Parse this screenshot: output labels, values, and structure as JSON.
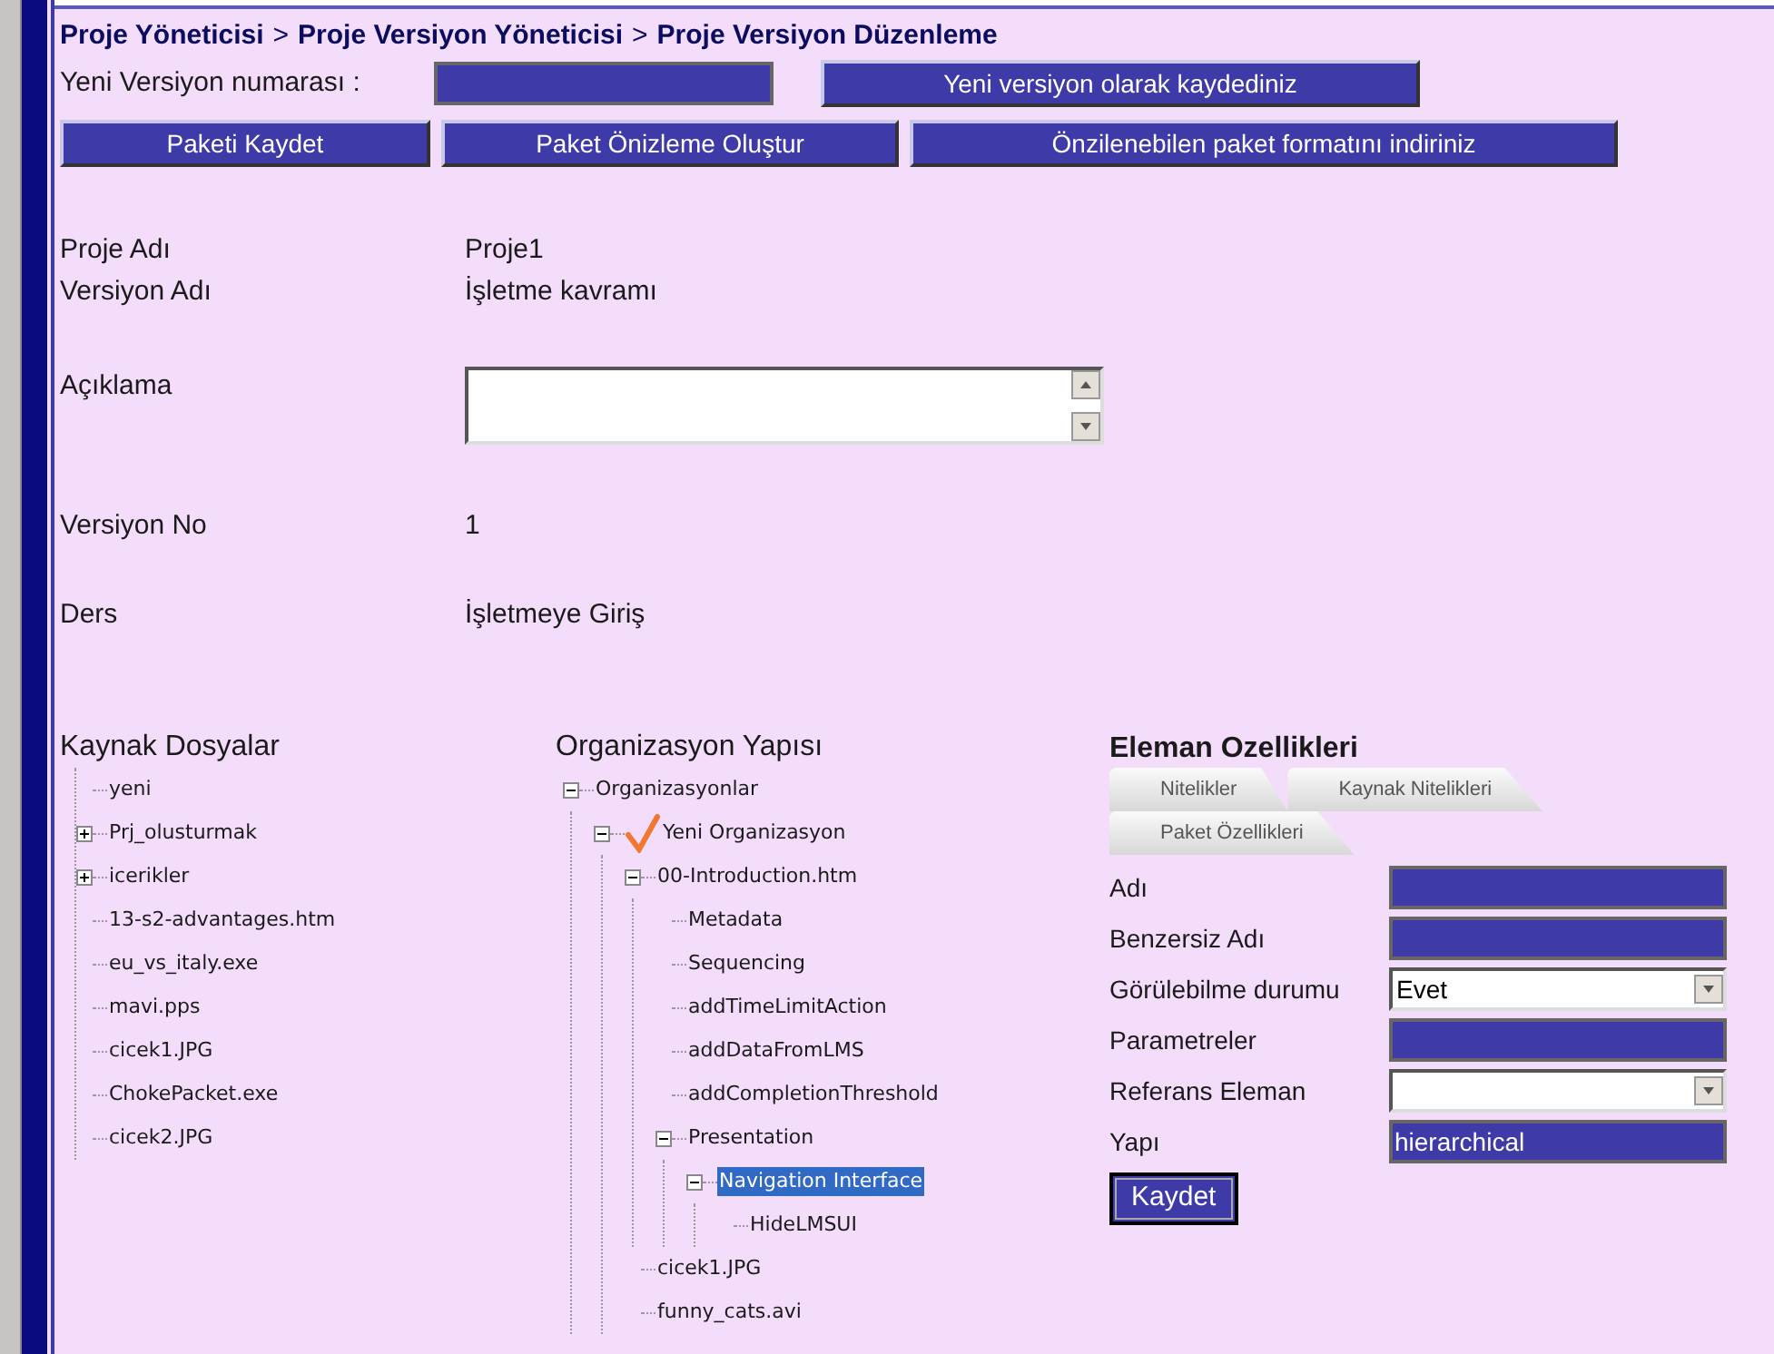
{
  "breadcrumb": [
    {
      "label": "Proje Yöneticisi",
      "separator": ">"
    },
    {
      "label": "Proje Versiyon Yöneticisi",
      "separator": ">"
    },
    {
      "label": "Proje Versiyon Düzenleme"
    }
  ],
  "new_version": {
    "label": "Yeni Versiyon numarası :",
    "button": "Yeni versiyon olarak kaydediniz"
  },
  "actions": [
    "Paketi Kaydet",
    "Paket Önizleme Oluştur",
    "Önzilenebilen paket formatını indiriniz"
  ],
  "info": [
    {
      "kind": "text",
      "label": "Proje Adı",
      "value": "Proje1"
    },
    {
      "kind": "text",
      "label": "Versiyon Adı",
      "value": "İşletme kavramı"
    },
    {
      "kind": "textarea",
      "label": "Açıklama"
    },
    {
      "kind": "text",
      "label": "Versiyon No",
      "value": "1"
    },
    {
      "kind": "text",
      "label": "Ders",
      "value": "İşletmeye Giriş"
    }
  ],
  "sources": {
    "title": "Kaynak Dosyalar",
    "items": [
      {
        "label": "yeni",
        "selected": false
      },
      {
        "label": "Prj_olusturmak",
        "expanded": false,
        "selected": false
      },
      {
        "label": "icerikler",
        "expanded": false,
        "selected": false
      },
      {
        "label": "13-s2-advantages.htm",
        "selected": false
      },
      {
        "label": "eu_vs_italy.exe",
        "selected": false
      },
      {
        "label": "mavi.pps",
        "selected": false
      },
      {
        "label": "cicek1.JPG",
        "selected": false
      },
      {
        "label": "ChokePacket.exe",
        "selected": false
      },
      {
        "label": "cicek2.JPG",
        "selected": false
      }
    ]
  },
  "organization": {
    "title": "Organizasyon Yapısı",
    "items": [
      {
        "label": "Organizasyonlar",
        "checked": false,
        "expanded": true,
        "selected": false,
        "children": [
          {
            "label": "Yeni Organizasyon",
            "checked": true,
            "expanded": true,
            "selected": false,
            "children": [
              {
                "label": "00-Introduction.htm",
                "checked": false,
                "expanded": true,
                "selected": false,
                "children": [
                  {
                    "label": "Metadata",
                    "checked": false,
                    "selected": false
                  },
                  {
                    "label": "Sequencing",
                    "checked": false,
                    "selected": false
                  },
                  {
                    "label": "addTimeLimitAction",
                    "checked": false,
                    "selected": false
                  },
                  {
                    "label": "addDataFromLMS",
                    "checked": false,
                    "selected": false
                  },
                  {
                    "label": "addCompletionThreshold",
                    "checked": false,
                    "selected": false
                  },
                  {
                    "label": "Presentation",
                    "checked": false,
                    "expanded": true,
                    "selected": false,
                    "children": [
                      {
                        "label": "Navigation Interface",
                        "checked": false,
                        "expanded": true,
                        "selected": true,
                        "children": [
                          {
                            "label": "HideLMSUI",
                            "checked": false,
                            "selected": false
                          }
                        ]
                      }
                    ]
                  }
                ]
              },
              {
                "label": "cicek1.JPG",
                "checked": false,
                "selected": false
              },
              {
                "label": "funny_cats.avi",
                "checked": false,
                "selected": false
              }
            ]
          }
        ]
      }
    ]
  },
  "properties": {
    "title": "Eleman Ozellikleri",
    "tabs": [
      {
        "label": "Nitelikler",
        "selected": false
      },
      {
        "label": "Kaynak Nitelikleri",
        "selected": false
      },
      {
        "label": "Paket Özellikleri",
        "selected": false
      }
    ],
    "fields": [
      {
        "kind": "input",
        "label": "Adı"
      },
      {
        "kind": "input",
        "label": "Benzersiz Adı"
      },
      {
        "kind": "select",
        "label": "Görülebilme durumu",
        "value": "Evet"
      },
      {
        "kind": "input",
        "label": "Parametreler"
      },
      {
        "kind": "select",
        "label": "Referans Eleman"
      },
      {
        "kind": "input",
        "label": "Yapı",
        "value": "hierarchical"
      }
    ],
    "save": "Kaydet"
  }
}
